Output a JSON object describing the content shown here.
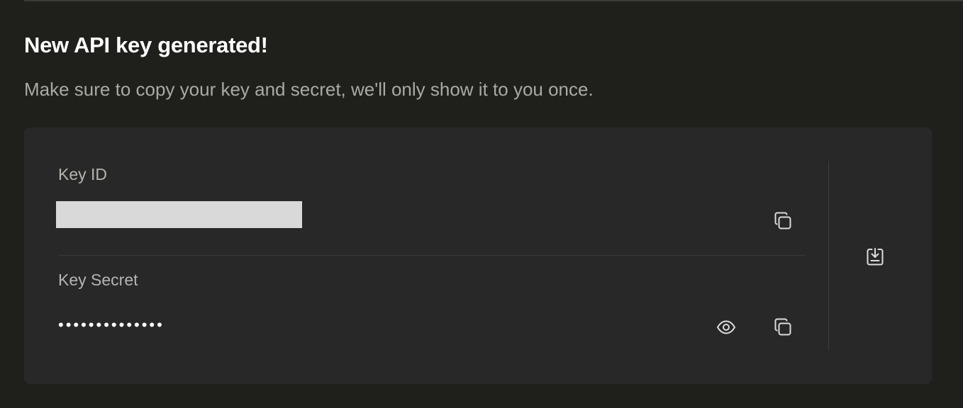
{
  "header": {
    "title": "New API key generated!",
    "subtitle": "Make sure to copy your key and secret, we'll only show it to you once."
  },
  "key_id": {
    "label": "Key ID",
    "value": ""
  },
  "key_secret": {
    "label": "Key Secret",
    "masked_value": "••••••••••••••"
  },
  "icons": {
    "copy": "copy-icon",
    "eye": "eye-icon",
    "download": "download-icon"
  },
  "colors": {
    "background": "#1f1f1b",
    "card": "#282828",
    "title": "#ffffff",
    "subtitle": "#a9a9a5",
    "label": "#b4b4b0",
    "icon": "#dcdcdc",
    "redacted": "#d9d9d9"
  }
}
